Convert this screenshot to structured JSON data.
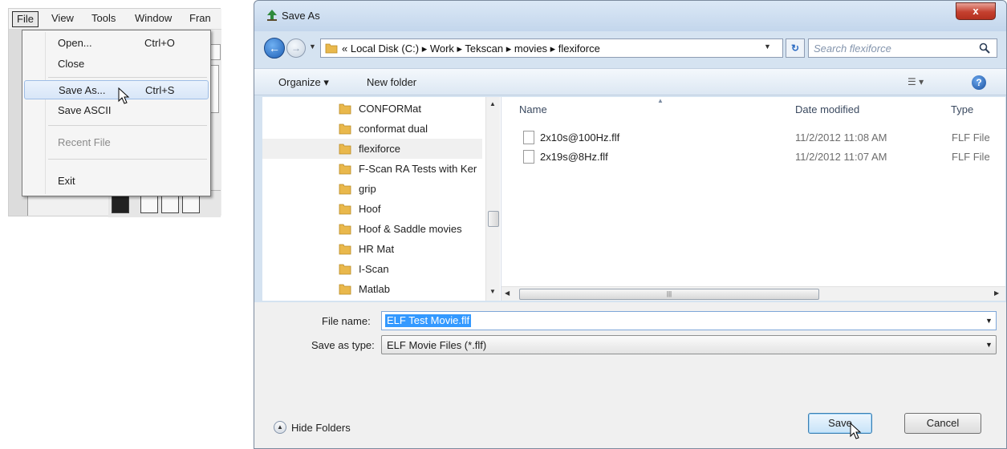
{
  "menu_bar": {
    "file": "File",
    "view": "View",
    "tools": "Tools",
    "window": "Window",
    "frame": "Fran"
  },
  "file_menu": {
    "items": [
      {
        "label": "Open...",
        "shortcut": "Ctrl+O"
      },
      {
        "label": "Close",
        "shortcut": ""
      },
      {
        "label": "Save As...",
        "shortcut": "Ctrl+S"
      },
      {
        "label": "Save ASCII",
        "shortcut": ""
      },
      {
        "label": "Recent File",
        "shortcut": ""
      },
      {
        "label": "Exit",
        "shortcut": ""
      }
    ]
  },
  "dialog": {
    "title": "Save As",
    "close_label": "x",
    "address": "« Local Disk (C:) ▸ Work ▸ Tekscan ▸ movies ▸ flexiforce",
    "search_placeholder": "Search flexiforce",
    "toolbar": {
      "organize": "Organize ▾",
      "new_folder": "New folder"
    },
    "nav_folders": [
      "CONFORMat",
      "conformat dual",
      "flexiforce",
      "F-Scan RA Tests with Ker",
      "grip",
      "Hoof",
      "Hoof & Saddle movies",
      "HR Mat",
      "I-Scan",
      "Matlab"
    ],
    "columns": {
      "name": "Name",
      "date": "Date modified",
      "type": "Type"
    },
    "files": [
      {
        "name": "2x10s@100Hz.flf",
        "date": "11/2/2012 11:08 AM",
        "type": "FLF File"
      },
      {
        "name": "2x19s@8Hz.flf",
        "date": "11/2/2012 11:07 AM",
        "type": "FLF File"
      }
    ],
    "file_name_label": "File name:",
    "file_name_value": "ELF Test Movie.flf",
    "save_type_label": "Save as type:",
    "save_type_value": "ELF Movie Files (*.flf)",
    "hide_folders": "Hide Folders",
    "save": "Save",
    "cancel": "Cancel"
  }
}
